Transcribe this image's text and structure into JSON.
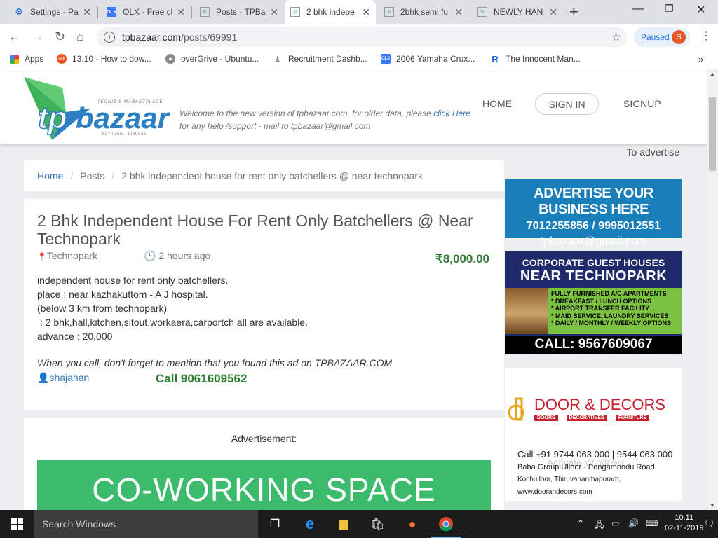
{
  "browser": {
    "tabs": [
      {
        "title": "Settings - Pa",
        "icon": "gear-icon",
        "active": false
      },
      {
        "title": "OLX - Free cl",
        "icon": "olx-icon",
        "active": false
      },
      {
        "title": "Posts - TPBaz",
        "icon": "tpbazaar-icon",
        "active": false
      },
      {
        "title": "2 bhk indepe",
        "icon": "tpbazaar-icon",
        "active": true
      },
      {
        "title": "2bhk semi fu",
        "icon": "tpbazaar-icon",
        "active": false
      },
      {
        "title": "NEWLY HAN",
        "icon": "tpbazaar-icon",
        "active": false
      }
    ],
    "address": {
      "domain": "tpbazaar.com",
      "path": "/posts/69991"
    },
    "paused_label": "Paused",
    "avatar_letter": "S",
    "bookmarks": [
      {
        "label": "Apps",
        "icon": "apps-grid-icon"
      },
      {
        "label": "13.10 - How to dow...",
        "icon": "askubuntu-icon"
      },
      {
        "label": "overGrive - Ubuntu...",
        "icon": "overgrive-icon"
      },
      {
        "label": "Recruitment Dashb...",
        "icon": "recruitment-icon"
      },
      {
        "label": "2006 Yamaha Crux...",
        "icon": "olx-icon"
      },
      {
        "label": "The Innocent Man...",
        "icon": "r-icon"
      }
    ]
  },
  "site": {
    "logo_text": "tpbazaar",
    "logo_tagline": "TECHIE'S MARKETPLACE",
    "logo_sub": "BUY | SELL | DISCUSS",
    "welcome_line1": "Welcome to the new version of tpbazaar.com, for older data, please ",
    "welcome_link": "click Here",
    "welcome_line2": "for any help /support - mail to tpbazaar@gmail.com",
    "nav": {
      "home": "HOME",
      "signin": "SIGN IN",
      "signup": "SIGNUP"
    }
  },
  "breadcrumb": {
    "home": "Home",
    "posts": "Posts",
    "current": "2 bhk independent house for rent only batchellers @ near technopark"
  },
  "post": {
    "title": "2 Bhk Independent House For Rent Only Batchellers @ Near Technopark",
    "location": "Technopark",
    "time": "2 hours ago",
    "price": "₹8,000.00",
    "description": [
      "independent house for rent only batchellers.",
      "place : near kazhakuttom - A J hospital.",
      "(below 3 km from technopark)",
      " : 2 bhk,hall,kitchen,sitout,workaera,carportch all are available.",
      "advance : 20,000"
    ],
    "note": "When you call, don't forget to mention that you found this ad on TPBAZAAR.COM",
    "seller": "shajahan",
    "call": "Call 9061609562"
  },
  "advert": {
    "label": "Advertisement:",
    "banner": "CO-WORKING SPACE"
  },
  "sidebar": {
    "to_advertise": "To advertise",
    "ad1": {
      "line1": "ADVERTISE YOUR BUSINESS HERE",
      "line2": "7012255856 / 9995012551",
      "line3": "tpbazaar@gmail.com"
    },
    "ad2": {
      "line1": "CORPORATE GUEST HOUSES",
      "line2": "NEAR TECHNOPARK",
      "features": [
        "FULLY FURNISHED A/C APARTMENTS",
        "* BREAKFAST / LUNCH OPTIONS",
        "* AIRPORT TRANSFER FACILITY",
        "* MAID SERVICE, LAUNDRY SERVICES",
        "* DAILY / MONTHLY / WEEKLY OPTIONS"
      ],
      "call": "CALL: 9567609067"
    },
    "ad3": {
      "brand": "DOOR & DECORS",
      "tags": [
        "DOORS",
        "DECORATIVES",
        "FURNITURE"
      ],
      "phone": "Call +91 9744 063 000 | 9544 063 000",
      "addr1": "Baba Group Ulloor - Pongamoodu Road,",
      "addr2": "Kochulloor, Thiruvananthapuram, www.doorandecors.com"
    }
  },
  "watermark": "Activate Windows",
  "taskbar": {
    "search_placeholder": "Search Windows",
    "time": "10:11",
    "date": "02-11-2019"
  },
  "colors": {
    "accent_green": "#2e7d32",
    "link_blue": "#337ab7",
    "cowork_green": "#3dbb6c",
    "ad_blue": "#1a7fb8",
    "ad_navy": "#1f2a6b"
  }
}
